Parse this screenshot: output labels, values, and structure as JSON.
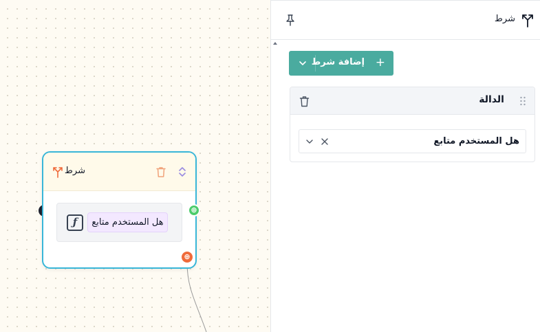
{
  "canvas": {
    "node": {
      "title": "شرط",
      "function_chip": "هل المستخدم متابع",
      "function_icon_glyph": "ƒ",
      "true_handle_glyph": "⊕",
      "false_handle_glyph": "⊕"
    }
  },
  "panel": {
    "title": "شرط",
    "add_button_label": "إضافة شرط",
    "add_button_plus": "+",
    "condition": {
      "title": "الدالة",
      "selected_value": "هل المستخدم متابع"
    }
  },
  "colors": {
    "node_border": "#38b6d8",
    "node_header": "#fffaea",
    "true_handle": "#4ccc6b",
    "false_handle": "#ef6a3a",
    "accent_button": "#4aab9f",
    "function_chip": "#f3e8ff"
  },
  "icons": {
    "node": [
      "split-icon",
      "trash-icon",
      "expand-icon",
      "function-icon"
    ],
    "panel": [
      "split-icon",
      "pin-icon",
      "plus-icon",
      "chevron-down-icon",
      "drag-handle-icon",
      "trash-icon",
      "close-icon"
    ]
  }
}
